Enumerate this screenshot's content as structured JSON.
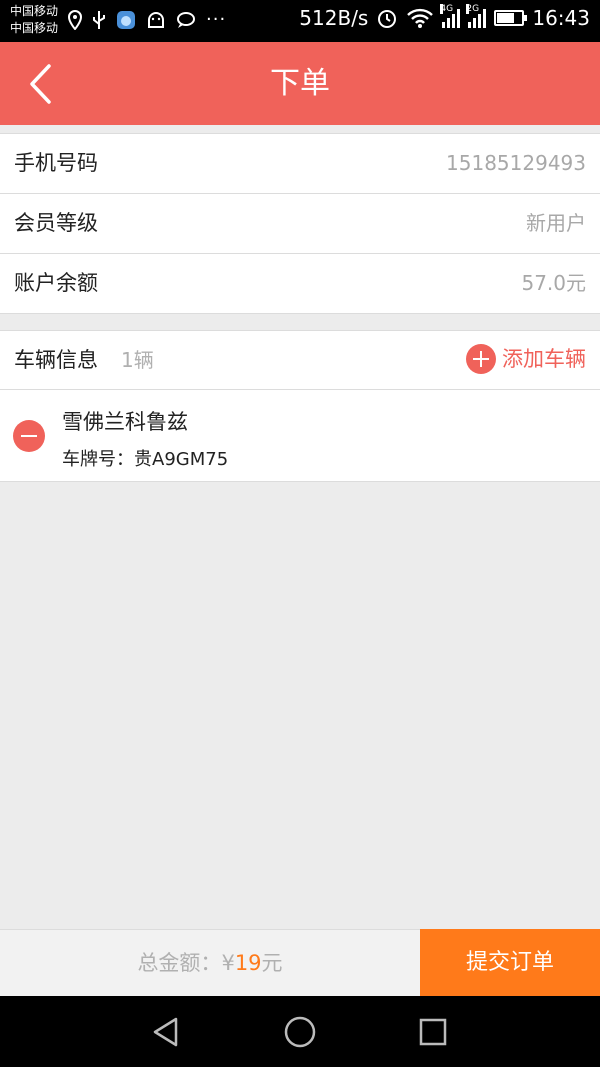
{
  "status_bar": {
    "carrier_1": "中国移动",
    "carrier_2": "中国移动",
    "net_speed": "512B/s",
    "net_4g": "4G",
    "net_2g": "2G",
    "time": "16:43",
    "icons": [
      "location-icon",
      "usb-icon",
      "app-icon",
      "android-icon",
      "chat-icon",
      "more-icon",
      "alarm-icon",
      "wifi-icon",
      "signal-icon",
      "battery-icon"
    ],
    "battery_level": 0.75
  },
  "header": {
    "title": "下单",
    "back_icon": "chevron-left-icon",
    "color": "#f0625a"
  },
  "account": {
    "rows": [
      {
        "label": "手机号码",
        "value": "15185129493"
      },
      {
        "label": "会员等级",
        "value": "新用户"
      },
      {
        "label": "账户余额",
        "value": "57.0元"
      }
    ]
  },
  "vehicles": {
    "title": "车辆信息",
    "count": "1辆",
    "add_label": "添加车辆",
    "items": [
      {
        "name": "雪佛兰科鲁兹",
        "plate_label": "车牌号：",
        "plate_value": "贵A9GM75"
      }
    ]
  },
  "order": {
    "total_label": "总金额：",
    "currency": "¥",
    "amount": "19",
    "unit": "元",
    "submit_label": "提交订单",
    "accent_color": "#ff7a1a"
  },
  "nav": {
    "icons": [
      "back-triangle-icon",
      "home-circle-icon",
      "recents-square-icon"
    ]
  }
}
